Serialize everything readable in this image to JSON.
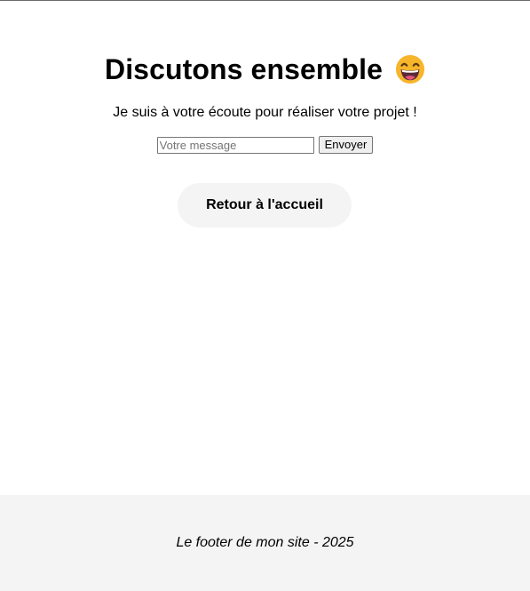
{
  "header": {
    "title": "Discutons ensemble",
    "title_emoji": "grinning-face-icon"
  },
  "main": {
    "subtitle": "Je suis à votre écoute pour réaliser votre projet !",
    "message_input": {
      "value": "",
      "placeholder": "Votre message"
    },
    "send_label": "Envoyer",
    "home_link_label": "Retour à l'accueil"
  },
  "footer": {
    "text": "Le footer de mon site - 2025"
  },
  "colors": {
    "emoji_face": "#f7b52b",
    "footer_bg": "#f4f4f4",
    "home_button_bg": "#f4f4f4"
  }
}
